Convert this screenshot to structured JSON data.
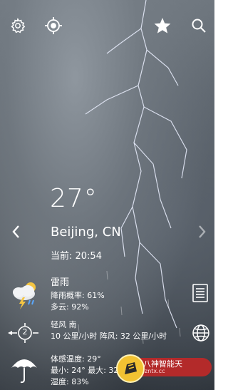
{
  "temperature": "27°",
  "city": "Beijing, CN",
  "current_time": "当前: 20:54",
  "condition": {
    "title": "雷雨",
    "precip": "降雨概率: 61%",
    "cloud": "多云: 92%"
  },
  "wind": {
    "line1": "轻风 南",
    "line2": "10 公里/小时 阵风: 32 公里/小时",
    "badge": "2"
  },
  "feels": {
    "line1": "体感温度: 29°",
    "line2": "最小: 24° 最大: 32°",
    "line3": "湿度: 83%"
  },
  "watermark": {
    "name": "八神智能天",
    "domain": "zntx.cc"
  }
}
